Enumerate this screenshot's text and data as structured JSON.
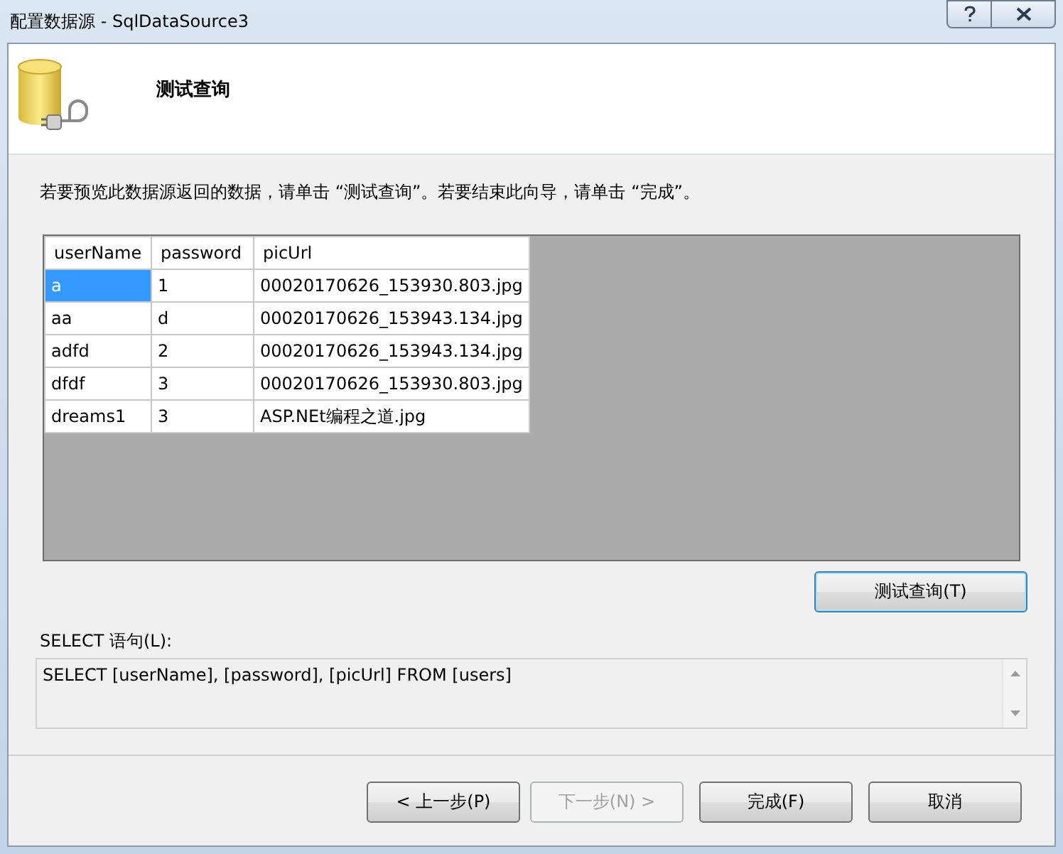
{
  "window": {
    "title": "配置数据源 - SqlDataSource3"
  },
  "header": {
    "title": "测试查询"
  },
  "instruction": "若要预览此数据源返回的数据，请单击 “测试查询”。若要结束此向导，请单击 “完成”。",
  "grid": {
    "columns": [
      "userName",
      "password",
      "picUrl"
    ],
    "rows": [
      {
        "cells": [
          {
            "text": "a",
            "selected": true
          },
          {
            "text": "1",
            "selected": false
          },
          {
            "text": "00020170626_153930.803.jpg",
            "selected": false
          }
        ]
      },
      {
        "cells": [
          {
            "text": "aa",
            "selected": false
          },
          {
            "text": "d",
            "selected": false
          },
          {
            "text": "00020170626_153943.134.jpg",
            "selected": false
          }
        ]
      },
      {
        "cells": [
          {
            "text": "adfd",
            "selected": false
          },
          {
            "text": "2",
            "selected": false
          },
          {
            "text": "00020170626_153943.134.jpg",
            "selected": false
          }
        ]
      },
      {
        "cells": [
          {
            "text": "dfdf",
            "selected": false
          },
          {
            "text": "3",
            "selected": false
          },
          {
            "text": "00020170626_153930.803.jpg",
            "selected": false
          }
        ]
      },
      {
        "cells": [
          {
            "text": "dreams1",
            "selected": false
          },
          {
            "text": "3",
            "selected": false
          },
          {
            "text": "ASP.NEt编程之道.jpg",
            "selected": false
          }
        ]
      }
    ]
  },
  "test_button": {
    "label": "测试查询(T)"
  },
  "select_label": "SELECT 语句(L):",
  "sql": "SELECT [userName], [password], [picUrl] FROM [users]",
  "buttons": [
    {
      "label": "< 上一步(P)",
      "disabled": false
    },
    {
      "label": "下一步(N) >",
      "disabled": true
    },
    {
      "label": "完成(F)",
      "disabled": false
    },
    {
      "label": "取消",
      "disabled": false
    }
  ]
}
